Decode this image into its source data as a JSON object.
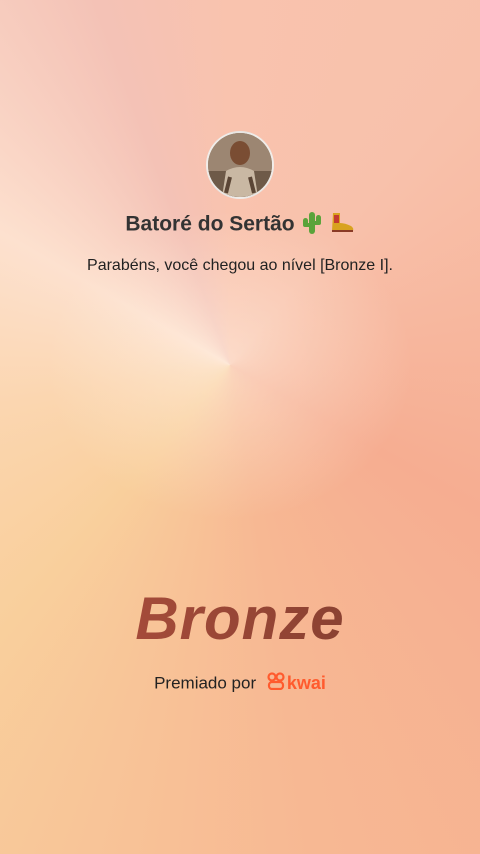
{
  "profile": {
    "name": "Batoré do Sertão",
    "emojis": [
      "cactus-icon",
      "cowboy-boot-icon"
    ]
  },
  "message": "Parabéns, você chegou ao nível [Bronze I].",
  "level": "Bronze",
  "award": {
    "prefix": "Premiado por",
    "brand": "kwai"
  },
  "colors": {
    "level": "#a64e3c",
    "brand": "#ff5b2e",
    "text": "#222222"
  }
}
